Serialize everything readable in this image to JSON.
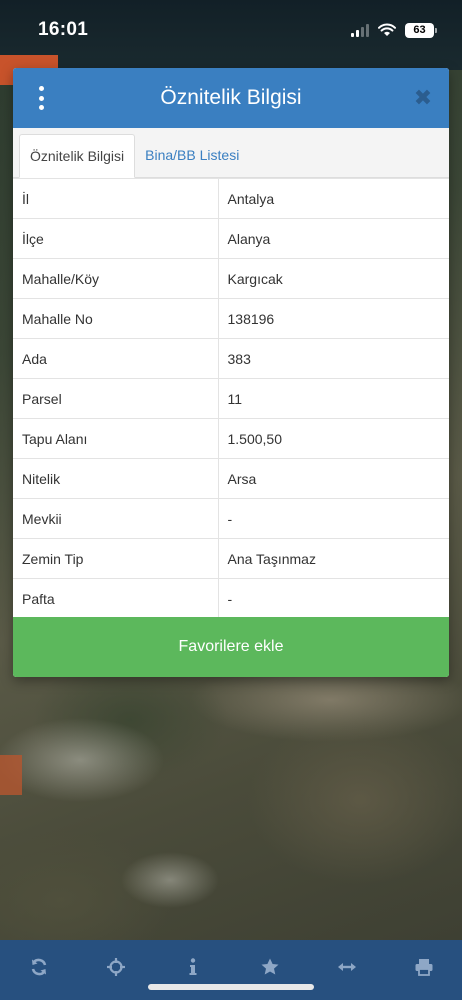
{
  "status": {
    "time": "16:01",
    "battery": "63"
  },
  "dialog": {
    "title": "Öznitelik Bilgisi",
    "tabs": [
      {
        "label": "Öznitelik Bilgisi",
        "active": true
      },
      {
        "label": "Bina/BB Listesi",
        "active": false
      }
    ],
    "rows": [
      {
        "key": "İl",
        "value": "Antalya"
      },
      {
        "key": "İlçe",
        "value": "Alanya"
      },
      {
        "key": "Mahalle/Köy",
        "value": "Kargıcak"
      },
      {
        "key": "Mahalle No",
        "value": "138196"
      },
      {
        "key": "Ada",
        "value": "383"
      },
      {
        "key": "Parsel",
        "value": "11"
      },
      {
        "key": "Tapu Alanı",
        "value": "1.500,50"
      },
      {
        "key": "Nitelik",
        "value": "Arsa"
      },
      {
        "key": "Mevkii",
        "value": "-"
      },
      {
        "key": "Zemin Tip",
        "value": "Ana Taşınmaz"
      },
      {
        "key": "Pafta",
        "value": "-"
      }
    ],
    "favorite_label": "Favorilere ekle"
  },
  "toolbar": {
    "icons": [
      "refresh-icon",
      "crosshair-icon",
      "info-icon",
      "star-icon",
      "measure-icon",
      "print-icon"
    ]
  },
  "colors": {
    "header": "#3a7fc1",
    "favorite": "#5cb85c",
    "toolbar": "#27507f",
    "toolbar_icon": "#8ea7c6"
  }
}
